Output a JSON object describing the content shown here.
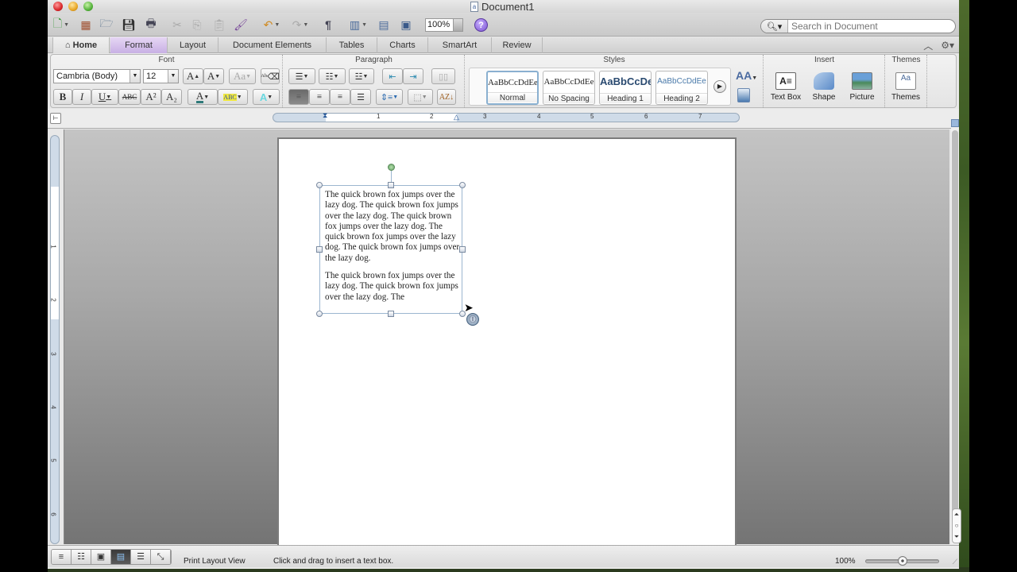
{
  "window": {
    "title": "Document1"
  },
  "toolbar": {
    "buttons": [
      "new-document",
      "gallery",
      "open",
      "save",
      "print",
      "cut",
      "copy",
      "paste",
      "format-painter",
      "undo",
      "redo",
      "show-formatting",
      "sidebar",
      "toolbox",
      "media-browser",
      "help"
    ],
    "zoom_value": "100%",
    "help_label": "?"
  },
  "search": {
    "placeholder": "Search in Document",
    "value": ""
  },
  "tabs": {
    "home": "Home",
    "items": [
      "Format",
      "Layout",
      "Document Elements",
      "Tables",
      "Charts",
      "SmartArt",
      "Review"
    ],
    "active": "Format"
  },
  "ribbon": {
    "font": {
      "title": "Font",
      "font_name": "Cambria (Body)",
      "font_size": "12",
      "grow": "A",
      "shrink": "A",
      "change_case": "Aa",
      "bold": "B",
      "italic": "I",
      "underline": "U",
      "strikethrough": "ABC",
      "superscript": "A²",
      "subscript": "A₂",
      "font_color": "#2f7a7a",
      "highlight_color": "#f0e840"
    },
    "paragraph": {
      "title": "Paragraph"
    },
    "styles": {
      "title": "Styles",
      "items": [
        {
          "sample": "AaBbCcDdEe",
          "name": "Normal",
          "selected": true
        },
        {
          "sample": "AaBbCcDdEe",
          "name": "No Spacing",
          "selected": false
        },
        {
          "sample": "AaBbCcDe",
          "name": "Heading 1",
          "selected": false
        },
        {
          "sample": "AaBbCcDdEe",
          "name": "Heading 2",
          "selected": false
        }
      ]
    },
    "insert": {
      "title": "Insert",
      "items": [
        "Text Box",
        "Shape",
        "Picture"
      ]
    },
    "themes": {
      "title": "Themes",
      "items": [
        "Themes"
      ]
    }
  },
  "ruler": {
    "h_numbers": [
      "1",
      "2",
      "3",
      "4",
      "5",
      "6",
      "7"
    ],
    "v_numbers": [
      "1",
      "2",
      "3",
      "4",
      "5",
      "6"
    ]
  },
  "document": {
    "textbox_paragraphs": [
      "The quick brown fox jumps over the lazy dog.  The quick brown fox jumps over the lazy dog.  The quick brown fox jumps over the lazy dog.  The quick brown fox jumps over the lazy dog.  The quick brown fox jumps over the lazy dog.",
      "The quick brown fox jumps over the lazy dog.  The quick brown fox jumps over the lazy dog.  The"
    ]
  },
  "statusbar": {
    "view_name": "Print Layout View",
    "hint": "Click and drag to insert a text box.",
    "zoom": "100%",
    "zoom_fraction": 0.5,
    "views": [
      "draft",
      "outline",
      "publishing-layout",
      "print-layout",
      "notebook-layout",
      "full-screen"
    ],
    "active_view": "print-layout"
  }
}
